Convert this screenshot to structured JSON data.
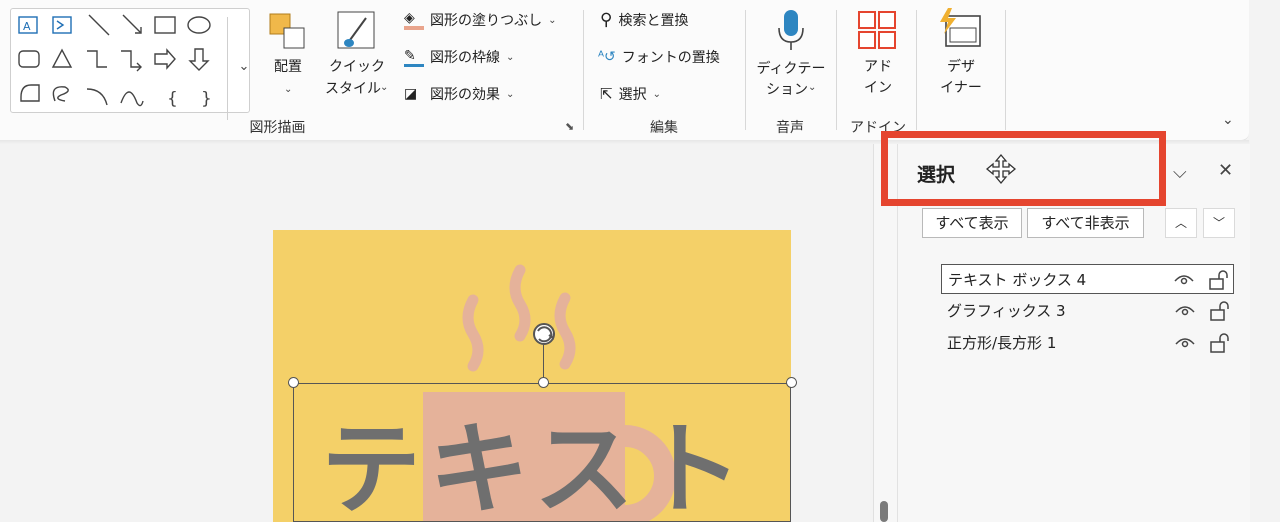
{
  "ribbon": {
    "groups": {
      "shapes": "図形描画",
      "edit": "編集",
      "voice": "音声",
      "addins": "アドイン"
    },
    "arrange": "配置",
    "quick_style_1": "クイック",
    "quick_style_2": "スタイル",
    "shape_fill": "図形の塗りつぶし",
    "shape_outline": "図形の枠線",
    "shape_effects": "図形の効果",
    "find_replace": "検索と置換",
    "font_replace": "フォントの置換",
    "select": "選択",
    "dictate_1": "ディクテー",
    "dictate_2": "ション",
    "addin_1": "アド",
    "addin_2": "イン",
    "designer_1": "デザ",
    "designer_2": "イナー"
  },
  "slide": {
    "text": "テキスト",
    "colors": {
      "background": "#f4d068",
      "cup": "#e5b29a",
      "text": "#6f6f6f"
    }
  },
  "pane": {
    "title": "選択",
    "show_all": "すべて表示",
    "hide_all": "すべて非表示",
    "items": [
      {
        "label": "テキスト ボックス 4"
      },
      {
        "label": "グラフィックス 3"
      },
      {
        "label": "正方形/長方形 1"
      }
    ]
  },
  "colors": {
    "highlight": "#e5452f"
  }
}
